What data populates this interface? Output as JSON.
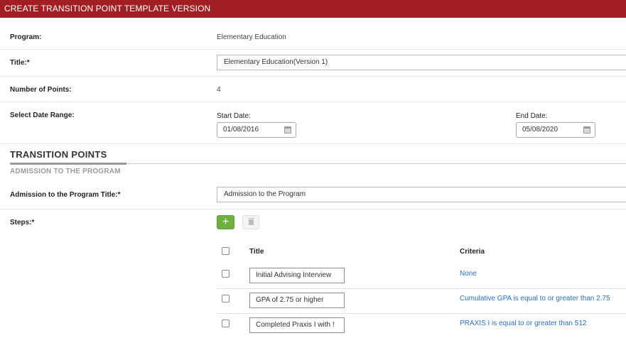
{
  "header": {
    "title": "CREATE TRANSITION POINT TEMPLATE VERSION"
  },
  "program": {
    "label": "Program:",
    "value": "Elementary Education"
  },
  "title_field": {
    "label": "Title:*",
    "value": "Elementary Education(Version 1)"
  },
  "points": {
    "label": "Number of Points:",
    "value": "4"
  },
  "date_range": {
    "label": "Select Date Range:",
    "start_label": "Start Date:",
    "start_value": "01/08/2016",
    "end_label": "End Date:",
    "end_value": "05/08/2020"
  },
  "section": {
    "title": "TRANSITION POINTS",
    "subtitle": "ADMISSION TO THE PROGRAM"
  },
  "admission_title": {
    "label": "Admission to the Program Title:*",
    "value": "Admission to the Program"
  },
  "steps": {
    "label": "Steps:*",
    "add_label": "+",
    "columns": {
      "title": "Title",
      "criteria": "Criteria"
    },
    "rows": [
      {
        "title": "Initial Advising Interview",
        "criteria": "None"
      },
      {
        "title": "GPA of 2.75 or higher",
        "criteria": "Cumulative GPA is equal to or greater than 2.75"
      },
      {
        "title": "Completed Praxis I with !",
        "criteria": "PRAXIS I is equal to or greater than 512"
      }
    ]
  }
}
